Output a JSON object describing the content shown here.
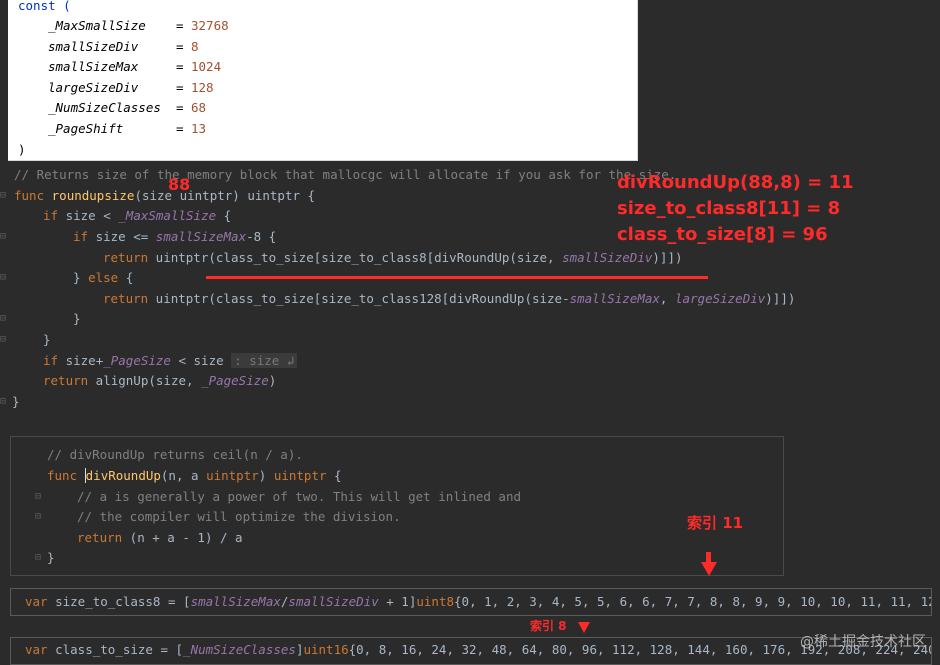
{
  "const_block": {
    "open": "const (",
    "close": ")",
    "rows": [
      {
        "name": "_MaxSmallSize",
        "pad": "   ",
        "value": "32768"
      },
      {
        "name": "smallSizeDiv",
        "pad": "    ",
        "value": "8"
      },
      {
        "name": "smallSizeMax",
        "pad": "    ",
        "value": "1024"
      },
      {
        "name": "largeSizeDiv",
        "pad": "    ",
        "value": "128"
      },
      {
        "name": "_NumSizeClasses",
        "pad": " ",
        "value": "68"
      },
      {
        "name": "_PageShift",
        "pad": "      ",
        "value": "13"
      }
    ]
  },
  "code": {
    "comment1": "// Returns size of the memory block that mallocgc will allocate if you ask for the size.",
    "func_kw": "func",
    "func_name": "roundupsize",
    "func_sig": "(size uintptr) uintptr {",
    "if1_kw": "if",
    "if1_rest": " size < ",
    "if1_id": "_MaxSmallSize",
    "if1_end": " {",
    "if2_kw": "if",
    "if2_rest": " size <= ",
    "if2_id": "smallSizeMax",
    "if2_end": "-8 {",
    "ret_kw": "return",
    "ret1_a": " uintptr(class_to_size[size_to_class8[divRoundUp(size, ",
    "ret1_id": "smallSizeDiv",
    "ret1_b": ")]])",
    "else_line": "} else {",
    "else_kw": "else",
    "ret2_a": " uintptr(class_to_size[size_to_class128[divRoundUp(size-",
    "ret2_id1": "smallSizeMax",
    "ret2_sep": ", ",
    "ret2_id2": "largeSizeDiv",
    "ret2_b": ")]])",
    "close_inner": "}",
    "close_mid": "}",
    "if3_kw": "if",
    "if3_rest": " size+",
    "if3_id": "_PageSize",
    "if3_end": " < size ",
    "if3_hint": ": size ↲",
    "ret3_kw": "return",
    "ret3_a": " alignUp(size, ",
    "ret3_id": "_PageSize",
    "ret3_b": ")",
    "close_func": "}"
  },
  "div_func": {
    "comment": "// divRoundUp returns ceil(n / a).",
    "func_kw": "func",
    "name": "divRoundUp",
    "sig_a": "(n, a ",
    "sig_type": "uintptr",
    "sig_b": ") ",
    "ret_type": "uintptr",
    "sig_c": " {",
    "c1": "// a is generally a power of two. This will get inlined and",
    "c2": "// the compiler will optimize the division.",
    "ret_kw": "return",
    "ret_body": " (n + a - 1) / a",
    "close": "}"
  },
  "bar1": {
    "kw": "var",
    "a": " size_to_class8 = [",
    "id1": "smallSizeMax",
    "slash": "/",
    "id2": "smallSizeDiv",
    "b": " + 1]",
    "type": "uint8",
    "values": "{0, 1, 2, 3, 4, 5, 5, 6, 6, 7, 7, 8, 8, 9, 9, 10, 10, 11, 11, 12"
  },
  "bar2": {
    "kw": "var",
    "a": " class_to_size = [",
    "id": "_NumSizeClasses",
    "b": "]",
    "type": "uint16",
    "values": "{0, 8, 16, 24, 32, 48, 64, 80, 96, 112, 128, 144, 160, 176, 192, 208, 224, 240,"
  },
  "annotations": {
    "n88": "88",
    "eq1": "divRoundUp(88,8) = 11",
    "eq2": "size_to_class8[11] = 8",
    "eq3": "class_to_size[8] = 96",
    "idx11": "索引 11",
    "idx8": "索引 8"
  },
  "watermark": "@稀土掘金技术社区",
  "colors": {
    "accent": "#ff2a2a",
    "bg": "#2b2b2b"
  }
}
